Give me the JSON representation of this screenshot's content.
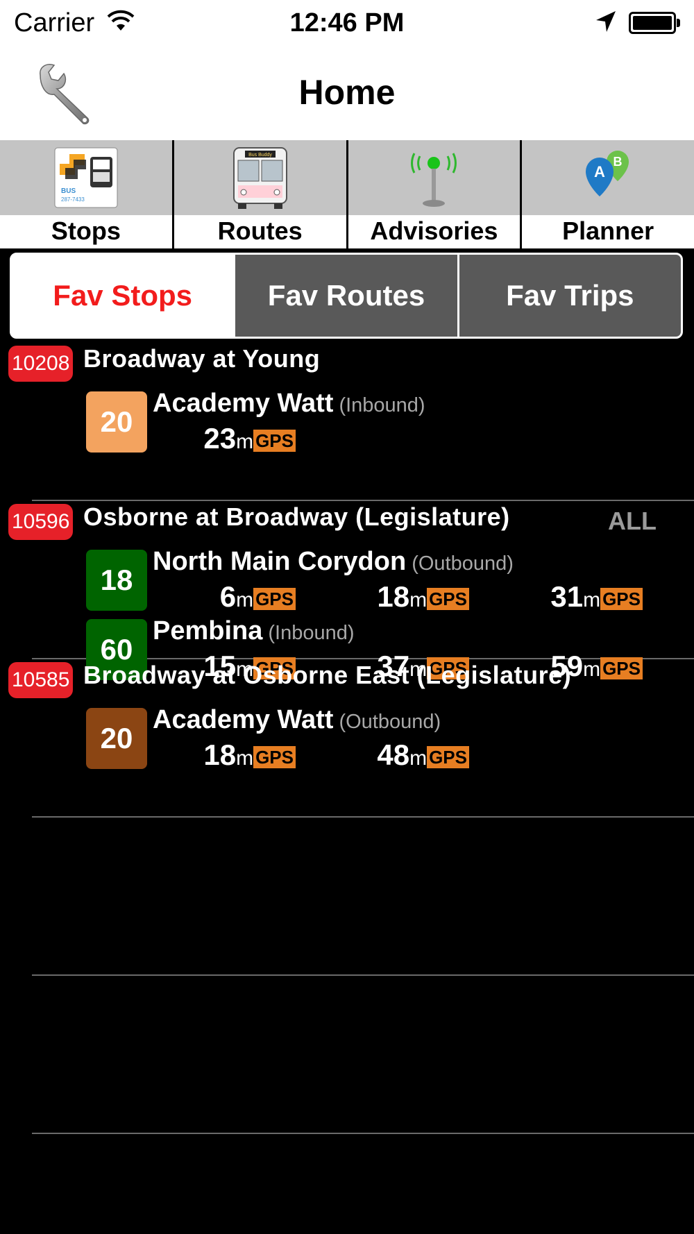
{
  "status_bar": {
    "carrier": "Carrier",
    "time": "12:46 PM"
  },
  "nav": {
    "title": "Home"
  },
  "tool_tabs": [
    {
      "label": "Stops",
      "icon": "stops-icon"
    },
    {
      "label": "Routes",
      "icon": "bus-icon"
    },
    {
      "label": "Advisories",
      "icon": "antenna-icon"
    },
    {
      "label": "Planner",
      "icon": "map-pins-icon"
    }
  ],
  "bus_sign_text": "Bus Buddy",
  "segments": [
    {
      "label": "Fav Stops",
      "active": true
    },
    {
      "label": "Fav Routes",
      "active": false
    },
    {
      "label": "Fav Trips",
      "active": false
    }
  ],
  "colors": {
    "stop_badge": "#e62129",
    "gps_tag": "#e77e22",
    "active_segment_text": "#f21c1c",
    "inactive_segment_bg": "#595959"
  },
  "stops": [
    {
      "number": "10208",
      "name": "Broadway at Young",
      "all_label": "",
      "routes": [
        {
          "route": "20",
          "color": "#f3a35f",
          "name": "Academy Watt",
          "direction": "(Inbound)",
          "etas": [
            "23"
          ]
        }
      ]
    },
    {
      "number": "10596",
      "name": "Osborne at Broadway (Legislature)",
      "all_label": "ALL",
      "routes": [
        {
          "route": "18",
          "color": "#006400",
          "name": "North Main Corydon",
          "direction": "(Outbound)",
          "etas": [
            "6",
            "18",
            "31"
          ]
        },
        {
          "route": "60",
          "color": "#006400",
          "name": "Pembina",
          "direction": "(Inbound)",
          "etas": [
            "15",
            "37",
            "59"
          ]
        }
      ]
    },
    {
      "number": "10585",
      "name": "Broadway at Osborne East (Legislature)",
      "all_label": "",
      "routes": [
        {
          "route": "20",
          "color": "#8b4513",
          "name": "Academy Watt",
          "direction": "(Outbound)",
          "etas": [
            "18",
            "48"
          ]
        }
      ]
    }
  ],
  "eta_unit": "m",
  "gps_label": "GPS"
}
